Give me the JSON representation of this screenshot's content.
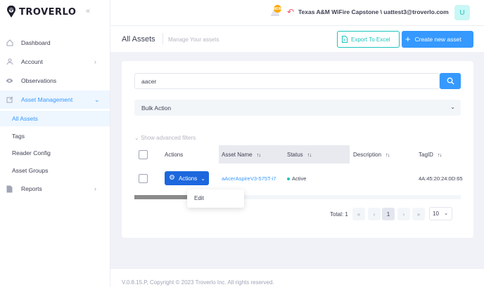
{
  "brand": {
    "name": "TROVERLO"
  },
  "sidebar": {
    "items": [
      {
        "label": "Dashboard",
        "icon": "home-icon"
      },
      {
        "label": "Account",
        "icon": "user-icon"
      },
      {
        "label": "Observations",
        "icon": "eye-icon"
      },
      {
        "label": "Asset Management",
        "icon": "edit-icon",
        "active": true
      },
      {
        "label": "Reports",
        "icon": "document-icon"
      }
    ],
    "sub_items": [
      {
        "label": "All Assets",
        "active": true
      },
      {
        "label": "Tags"
      },
      {
        "label": "Reader Config"
      },
      {
        "label": "Asset Groups"
      }
    ]
  },
  "header": {
    "notification_count": "NEW",
    "org_user": "Texas A&M WiFire Capstone \\ uattest3@troverlo.com",
    "avatar_initial": "U"
  },
  "subheader": {
    "title": "All Assets",
    "subtitle": "Manage Your assets",
    "export_label": "Export To Excel",
    "create_label": "Create new asset"
  },
  "filters": {
    "search_value": "aacer",
    "bulk_action": "Bulk Action",
    "advanced_filters": "Show advanced filters"
  },
  "table": {
    "headers": {
      "actions": "Actions",
      "asset_name": "Asset Name",
      "status": "Status",
      "description": "Description",
      "tag_id": "TagID"
    },
    "rows": [
      {
        "actions_label": "Actions",
        "asset_name": "aAcerAspireV3-575T-i7",
        "status": "Active",
        "description": "",
        "tag_id": "4A:45:20:24:0D:65"
      }
    ]
  },
  "actions_menu": {
    "items": [
      "Edit"
    ]
  },
  "pagination": {
    "total_label": "Total: 1",
    "first": "«",
    "prev": "‹",
    "current": "1",
    "next": "›",
    "last": "»",
    "page_size": "10"
  },
  "footer": {
    "text": "V.0.8.15.P,   Copyright © 2023 Troverlo Inc. All rights reserved."
  },
  "colors": {
    "primary": "#3699ff",
    "actions_button": "#1c67dd",
    "success": "#1bc5bd",
    "danger": "#f64e60"
  }
}
